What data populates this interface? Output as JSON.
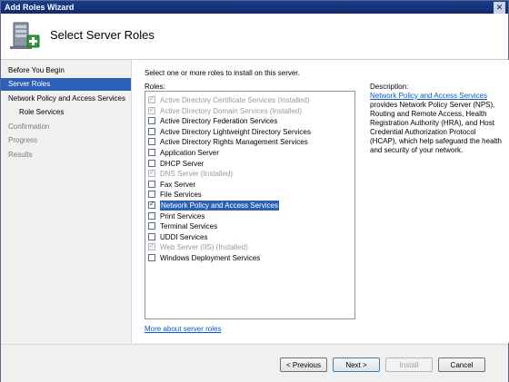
{
  "window": {
    "title": "Add Roles Wizard",
    "close_glyph": "✕"
  },
  "header": {
    "title": "Select Server Roles",
    "icon": "server-add-icon"
  },
  "nav": {
    "items": [
      {
        "label": "Before You Begin"
      },
      {
        "label": "Server Roles"
      },
      {
        "label": "Network Policy and Access Services"
      },
      {
        "label": "Role Services"
      },
      {
        "label": "Confirmation"
      },
      {
        "label": "Progress"
      },
      {
        "label": "Results"
      }
    ]
  },
  "main": {
    "instruction": "Select one or more roles to install on this server.",
    "roles_label": "Roles:",
    "roles": [
      {
        "label": "Active Directory Certificate Services  (Installed)",
        "checked": true,
        "disabled": true
      },
      {
        "label": "Active Directory Domain Services  (Installed)",
        "checked": true,
        "disabled": true
      },
      {
        "label": "Active Directory Federation Services",
        "checked": false,
        "disabled": false
      },
      {
        "label": "Active Directory Lightweight Directory Services",
        "checked": false,
        "disabled": false
      },
      {
        "label": "Active Directory Rights Management Services",
        "checked": false,
        "disabled": false
      },
      {
        "label": "Application Server",
        "checked": false,
        "disabled": false
      },
      {
        "label": "DHCP Server",
        "checked": false,
        "disabled": false
      },
      {
        "label": "DNS Server  (Installed)",
        "checked": true,
        "disabled": true
      },
      {
        "label": "Fax Server",
        "checked": false,
        "disabled": false
      },
      {
        "label": "File Services",
        "checked": false,
        "disabled": false
      },
      {
        "label": "Network Policy and Access Services",
        "checked": true,
        "disabled": false,
        "selected": true
      },
      {
        "label": "Print Services",
        "checked": false,
        "disabled": false
      },
      {
        "label": "Terminal Services",
        "checked": false,
        "disabled": false
      },
      {
        "label": "UDDI Services",
        "checked": false,
        "disabled": false
      },
      {
        "label": "Web Server (IIS)  (Installed)",
        "checked": true,
        "disabled": true
      },
      {
        "label": "Windows Deployment Services",
        "checked": false,
        "disabled": false
      }
    ],
    "more_link": "More about server roles",
    "description_label": "Description:",
    "description_link": "Network Policy and Access Services",
    "description_text": "provides Network Policy Server (NPS), Routing and Remote Access, Health Registration Authority (HRA), and Host Credential Authorization Protocol (HCAP), which help safeguard the health and security of your network."
  },
  "footer": {
    "previous": "< Previous",
    "next": "Next >",
    "install": "Install",
    "cancel": "Cancel"
  }
}
